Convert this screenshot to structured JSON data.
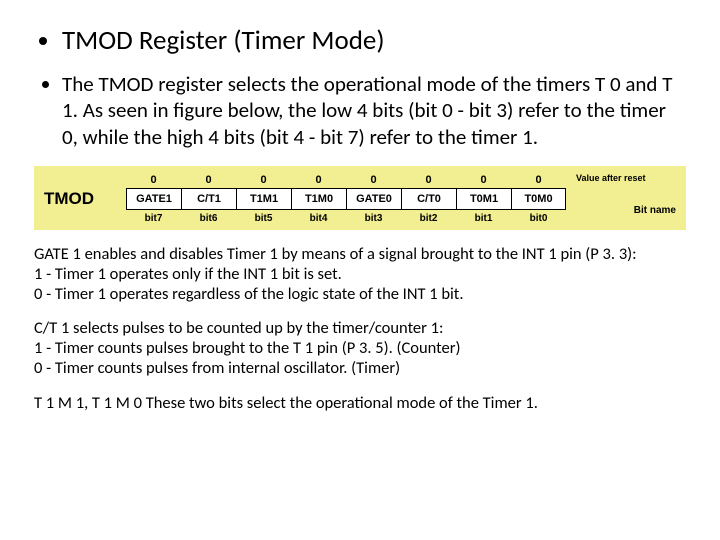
{
  "title": "TMOD Register (Timer Mode)",
  "intro": "The TMOD register selects the operational mode of the timers T 0 and T 1. As seen in figure below, the low 4 bits (bit 0 - bit 3) refer to the timer 0, while the high 4 bits (bit 4 - bit 7) refer to the timer 1.",
  "diagram": {
    "name": "TMOD",
    "reset_label": "Value after reset",
    "bitname_label": "Bit name",
    "bits": [
      {
        "name": "GATE1",
        "idx": "bit7",
        "reset": "0"
      },
      {
        "name": "C/T1",
        "idx": "bit6",
        "reset": "0"
      },
      {
        "name": "T1M1",
        "idx": "bit5",
        "reset": "0"
      },
      {
        "name": "T1M0",
        "idx": "bit4",
        "reset": "0"
      },
      {
        "name": "GATE0",
        "idx": "bit3",
        "reset": "0"
      },
      {
        "name": "C/T0",
        "idx": "bit2",
        "reset": "0"
      },
      {
        "name": "T0M1",
        "idx": "bit1",
        "reset": "0"
      },
      {
        "name": "T0M0",
        "idx": "bit0",
        "reset": "0"
      }
    ]
  },
  "notes": {
    "gate1_a": "GATE 1 enables and disables Timer 1 by means of a signal brought to the INT 1 pin (P 3. 3):",
    "gate1_b": "1 - Timer 1 operates only if the INT 1 bit is set.",
    "gate1_c": "0 - Timer 1 operates regardless of the logic state of the INT 1 bit.",
    "ct1_a": "C/T 1 selects pulses to be counted up by the timer/counter 1:",
    "ct1_b": "1 - Timer counts pulses brought to the T 1 pin (P 3. 5). (Counter)",
    "ct1_c": "0 - Timer counts pulses from internal oscillator. (Timer)",
    "t1m": "T 1 M 1, T 1 M 0 These two bits select the operational mode of the Timer 1."
  }
}
